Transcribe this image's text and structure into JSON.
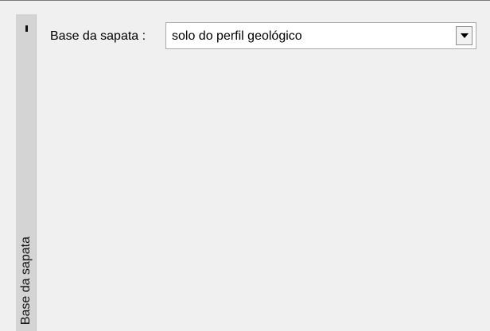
{
  "side_tab": {
    "label": "Base da sapata"
  },
  "form": {
    "base_label": "Base da sapata :",
    "base_value": "solo do perfil geológico"
  },
  "icons": {
    "dropdown": "chevron-down-icon",
    "tab_marker": "tab-marker-icon"
  }
}
